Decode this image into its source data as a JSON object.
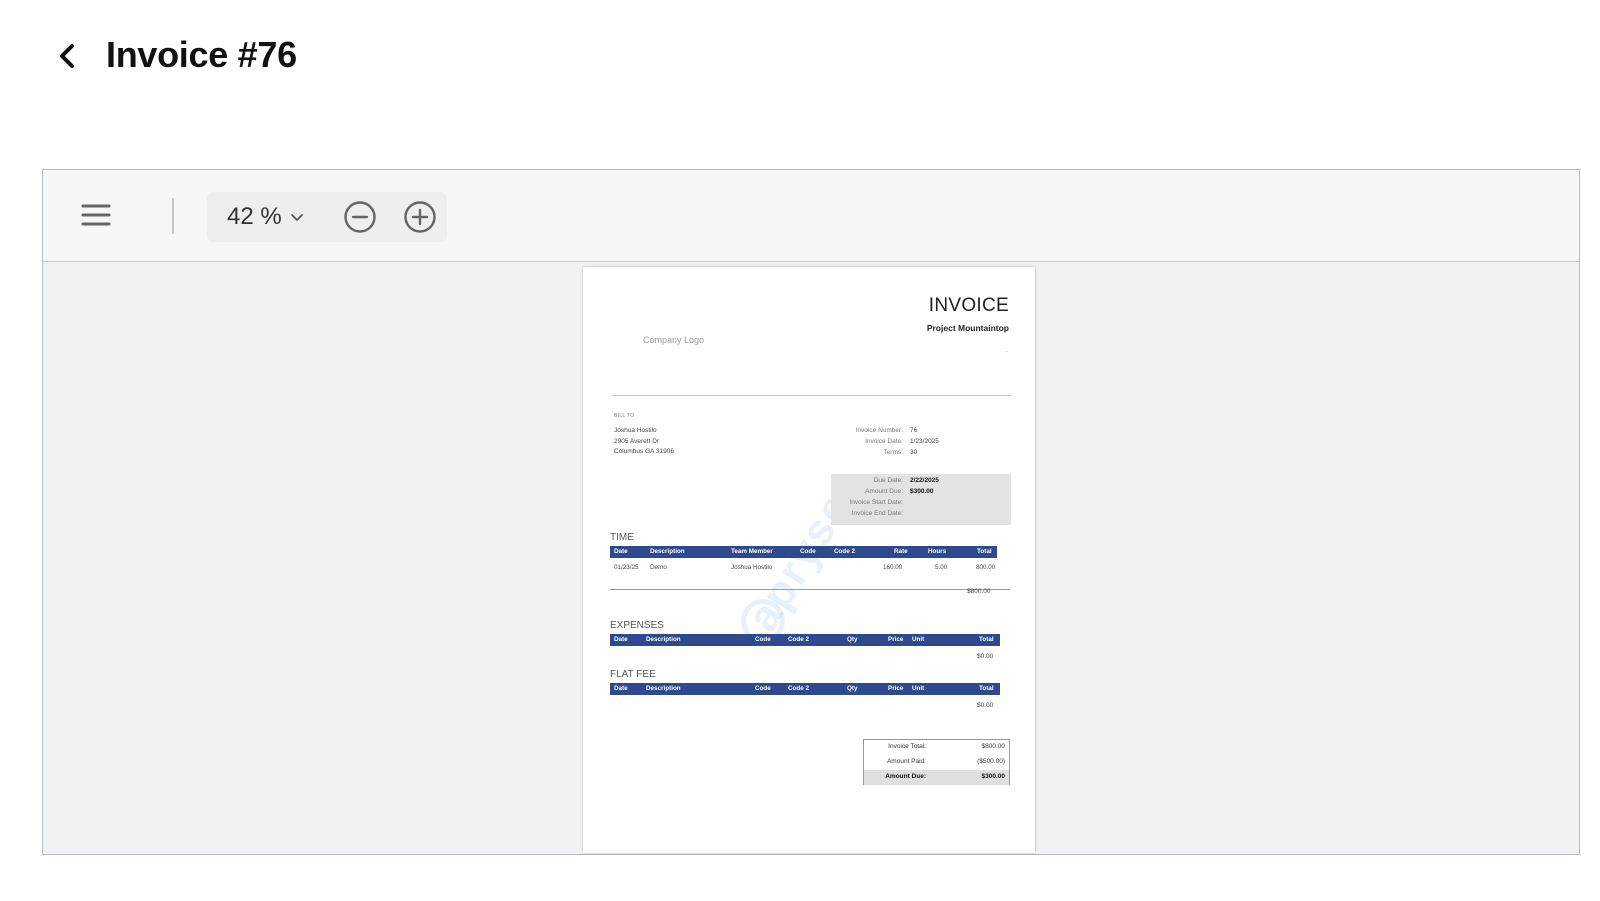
{
  "header": {
    "title": "Invoice #76",
    "back_icon": "chevron-left-icon"
  },
  "toolbar": {
    "menu_icon": "hamburger-menu-icon",
    "zoom_value": "42 %",
    "zoom_caret_icon": "chevron-down-icon",
    "zoom_out_icon": "minus-circle-icon",
    "zoom_in_icon": "plus-circle-icon"
  },
  "document": {
    "title": "INVOICE",
    "project": "Project Mountaintop",
    "dot": ".",
    "logo_placeholder": "Company Logo",
    "bill_to": {
      "label": "BILL TO",
      "lines": [
        "Joshua Hostilo",
        "2905 Averett Dr",
        "Columbus GA 31906"
      ]
    },
    "meta": [
      {
        "label": "Invoice Number:",
        "value": "76"
      },
      {
        "label": "Invoice Date:",
        "value": "1/23/2025"
      },
      {
        "label": "Terms:",
        "value": "30"
      }
    ],
    "due": [
      {
        "label": "Due Date:",
        "value": "2/22/2025"
      },
      {
        "label": "Amount Due:",
        "value": "$300.00"
      },
      {
        "label": "Invoice Start Date:",
        "value": ""
      },
      {
        "label": "Invoice End Date:",
        "value": ""
      }
    ],
    "time": {
      "title": "TIME",
      "columns": [
        "Date",
        "Description",
        "Team Member",
        "Code",
        "Code 2",
        "Rate",
        "Hours",
        "Total"
      ],
      "rows": [
        {
          "date": "01/23/25",
          "description": "Demo",
          "team_member": "Joshua Hostilo",
          "rate": "160.00",
          "hours": "5.00",
          "total": "800.00"
        }
      ],
      "subtotal": "$800.00"
    },
    "expenses": {
      "title": "EXPENSES",
      "columns": [
        "Date",
        "Description",
        "Code",
        "Code 2",
        "Qty",
        "Price",
        "Unit",
        "Total"
      ],
      "subtotal": "$0.00"
    },
    "flat_fee": {
      "title": "FLAT FEE",
      "columns": [
        "Date",
        "Description",
        "Code",
        "Code 2",
        "Qty",
        "Price",
        "Unit",
        "Total"
      ],
      "subtotal": "$0.00"
    },
    "totals": {
      "invoice_total_label": "Invoice Total:",
      "invoice_total": "$800.00",
      "amount_paid_label": "Amount Paid:",
      "amount_paid": "($500.00)",
      "amount_due_label": "Amount Due:",
      "amount_due": "$300.00"
    },
    "watermark": "apryse"
  }
}
